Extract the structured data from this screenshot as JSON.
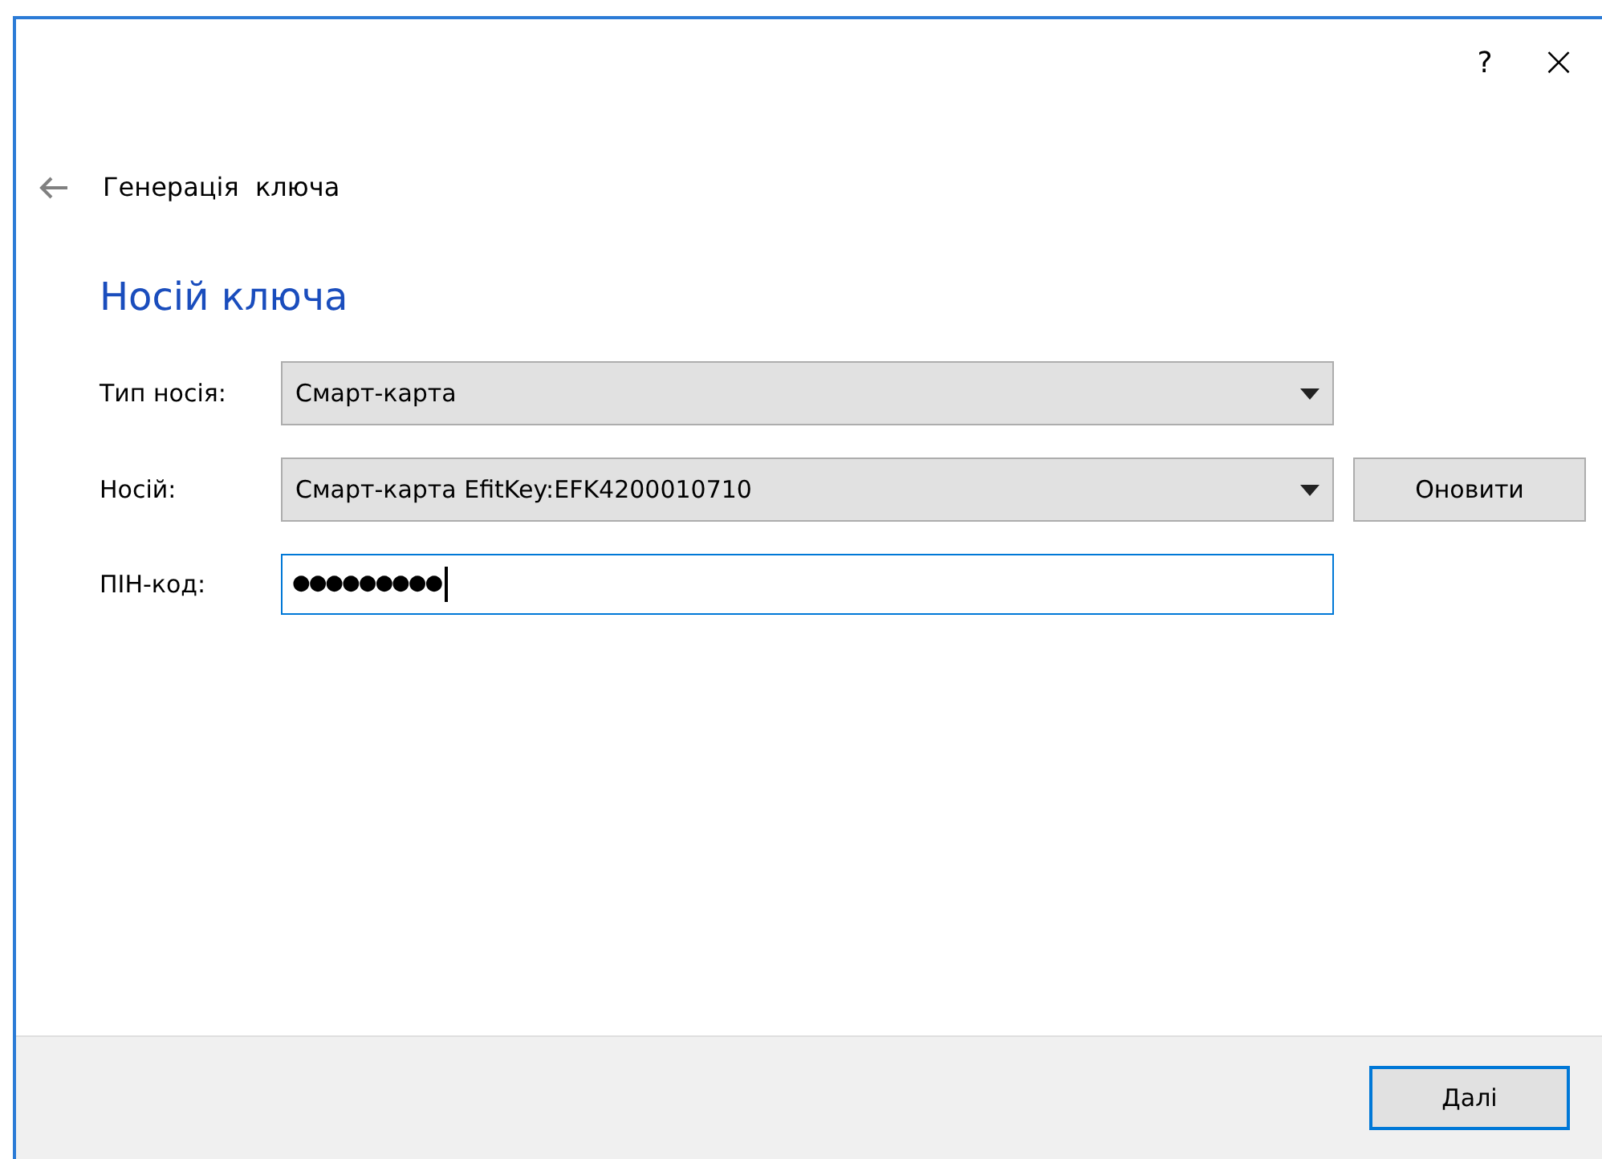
{
  "title_bar": {
    "help": "?",
    "close": "×"
  },
  "header": {
    "title": "Генерація  ключа"
  },
  "section_title": "Носій ключа",
  "fields": [
    {
      "kind": "combo",
      "label": "Тип носія:",
      "value": "Смарт-карта"
    },
    {
      "kind": "combo",
      "label": "Носій:",
      "value": "Смарт-карта EfitKey:EFK4200010710",
      "button": "Оновити"
    },
    {
      "kind": "password",
      "label": "ПІН-код:",
      "value": "●●●●●●●●●",
      "focused": true
    }
  ],
  "footer": {
    "buttons": [
      {
        "label": "Далі",
        "default": true
      }
    ]
  }
}
